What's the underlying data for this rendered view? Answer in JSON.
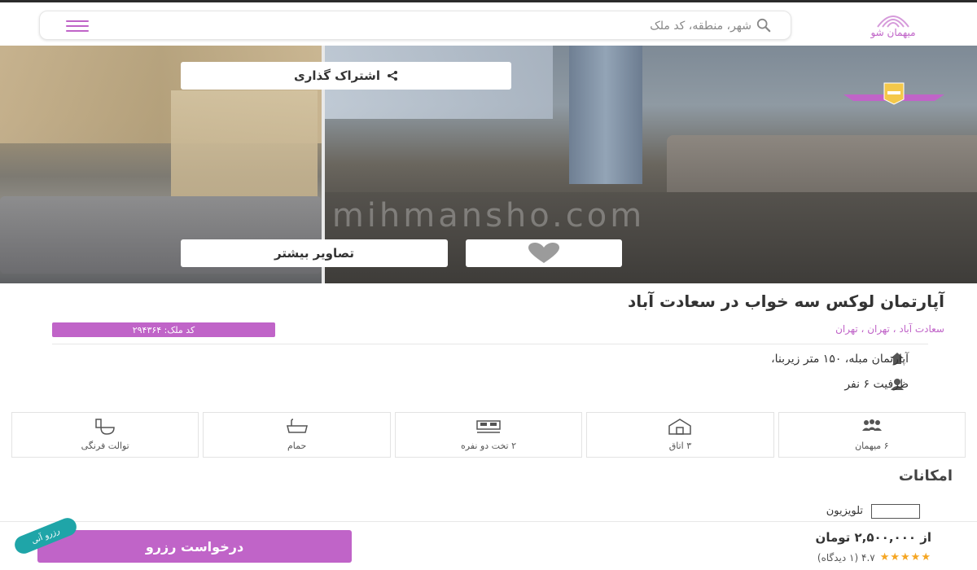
{
  "header": {
    "logo_text": "میهمان شو",
    "search_placeholder": "شهر، منطقه، کد ملک"
  },
  "hero": {
    "share_label": "اشتراک گذاری",
    "more_images_label": "تصاویر بیشتر",
    "watermark": "mihmansho.com"
  },
  "listing": {
    "title": "آپارتمان لوکس سه خواب در سعادت آباد",
    "location": "سعادت آباد ، تهران ، تهران",
    "code_label": "کد ملک: ۲۹۴۳۶۴",
    "feature_1": "آپارتمان مبله، ۱۵۰ متر زیربنا،",
    "feature_2": "ظرفیت ۶ نفر"
  },
  "specs": [
    {
      "label": "توالت فرنگی",
      "icon": "toilet-icon"
    },
    {
      "label": "حمام",
      "icon": "bathtub-icon"
    },
    {
      "label": "۲ تخت دو نفره",
      "icon": "double-bed-icon"
    },
    {
      "label": "۳ اتاق",
      "icon": "room-icon"
    },
    {
      "label": "۶ میهمان",
      "icon": "guests-icon"
    }
  ],
  "amenities": {
    "title": "امکانات",
    "items": [
      {
        "label": "تلویزیون",
        "icon": "tv-icon"
      }
    ]
  },
  "bottom": {
    "reserve_label": "درخواست رزرو",
    "instant_label": "رزرو آنی",
    "price": "از ۲,۵۰۰,۰۰۰ تومان",
    "rating": "۴.۷ (۱ دیدگاه)",
    "stars": "★★★★★",
    "rating_value": 4.7
  },
  "colors": {
    "accent": "#c064c8",
    "instant": "#1fa5a8",
    "star": "#f5a623"
  }
}
